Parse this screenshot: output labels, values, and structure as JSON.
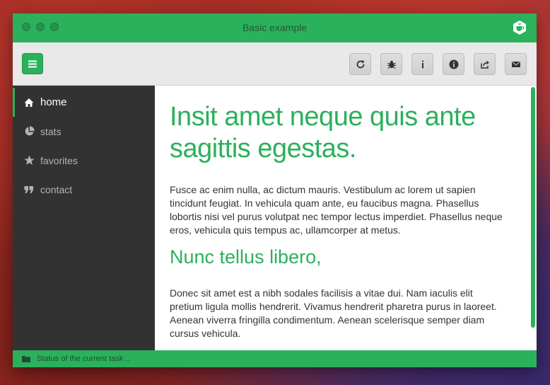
{
  "window": {
    "title": "Basic example"
  },
  "icons": {
    "brand": "coffee-cup-hexagon-icon",
    "menu": "hamburger-icon",
    "toolbar": [
      "refresh-icon",
      "bug-icon",
      "info-i-icon",
      "info-circle-icon",
      "share-icon",
      "mail-icon"
    ]
  },
  "sidebar": {
    "items": [
      {
        "label": "home",
        "icon": "home-icon",
        "active": true
      },
      {
        "label": "stats",
        "icon": "pie-chart-icon",
        "active": false
      },
      {
        "label": "favorites",
        "icon": "star-icon",
        "active": false
      },
      {
        "label": "contact",
        "icon": "quote-icon",
        "active": false
      }
    ]
  },
  "main": {
    "heading": "Insit amet neque quis ante sagittis egestas.",
    "para1": "Fusce ac enim nulla, ac dictum mauris. Vestibulum ac lorem ut sapien tincidunt feugiat. In vehicula quam ante, eu faucibus magna. Phasellus lobortis nisi vel purus volutpat nec tempor lectus imperdiet. Phasellus neque eros, vehicula quis tempus ac, ullamcorper at metus.",
    "subheading": "Nunc tellus libero,",
    "para2": "Donec sit amet est a nibh sodales facilisis a vitae dui. Nam iaculis elit pretium ligula mollis hendrerit. Vivamus hendrerit pharetra purus in laoreet. Aenean viverra fringilla condimentum. Aenean scelerisque semper diam cursus vehicula."
  },
  "status": {
    "text": "Status of the current task ..",
    "icon": "folder-icon"
  },
  "colors": {
    "accent": "#2bb15c",
    "sidebar": "#323232",
    "toolbar": "#e9e9e9"
  }
}
